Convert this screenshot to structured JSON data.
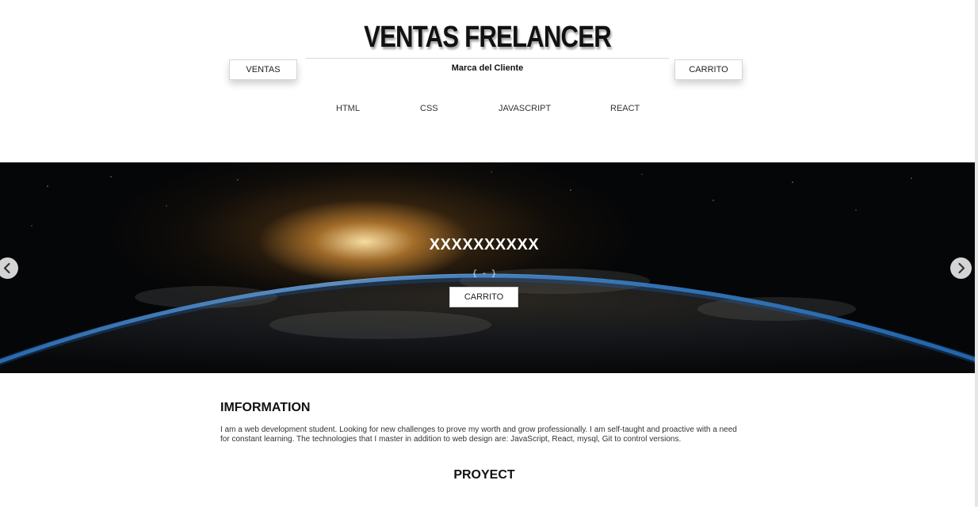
{
  "header": {
    "site_title": "VENTAS FRELANCER",
    "brand_label": "Marca del Cliente",
    "left_button": "VENTAS",
    "right_button": "CARRITO"
  },
  "nav": {
    "items": [
      {
        "label": "HTML"
      },
      {
        "label": "CSS"
      },
      {
        "label": "JAVASCRIPT"
      },
      {
        "label": "REACT"
      }
    ]
  },
  "hero": {
    "title": "XXXXXXXXXX",
    "subtitle": "{ - }",
    "button_label": "CARRITO",
    "prev_icon": "chevron-left-icon",
    "next_icon": "chevron-right-icon"
  },
  "information": {
    "title": "IMFORMATION",
    "text": "I am a web development student. Looking for new challenges to prove my worth and grow professionally. I am self-taught and proactive with a need for constant learning. The technologies that I master in addition to web design are: JavaScript, React, mysql, Git to control versions."
  },
  "proyect": {
    "title": "PROYECT"
  },
  "colors": {
    "hero_background": "#050608",
    "sun_glow": "#f0a03c",
    "earth_rim": "#3a8ad6"
  }
}
